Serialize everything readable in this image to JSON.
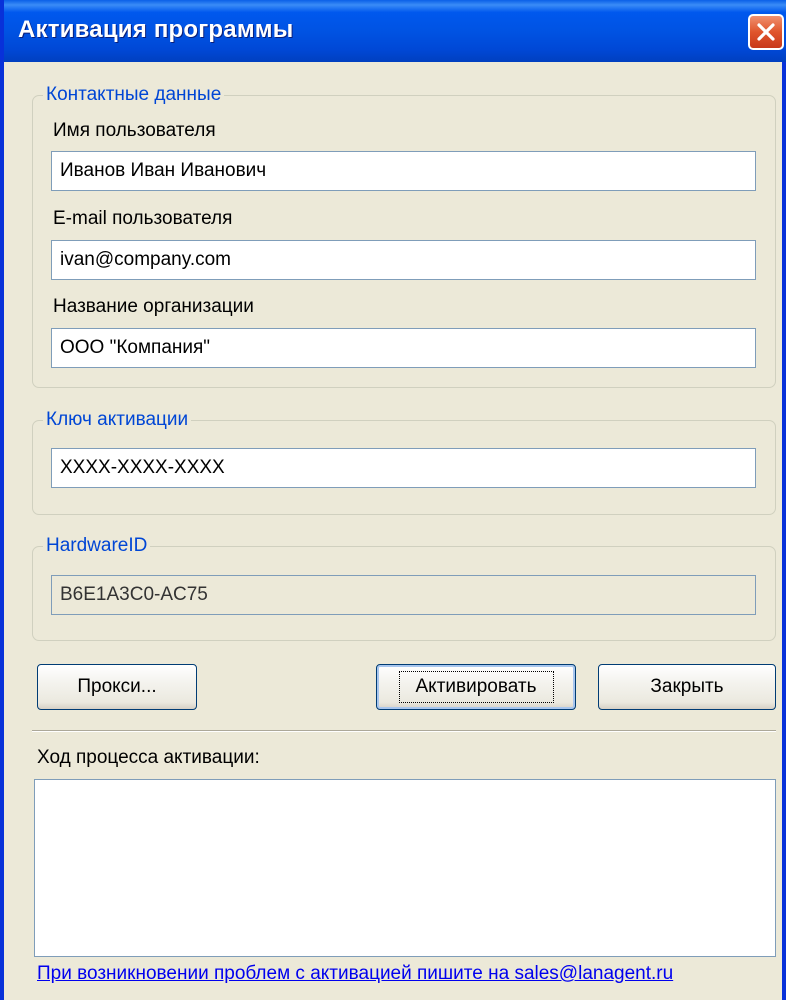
{
  "window": {
    "title": "Активация программы"
  },
  "contacts": {
    "legend": "Контактные данные",
    "username_label": "Имя пользователя",
    "username_value": "Иванов Иван Иванович",
    "email_label": "E-mail пользователя",
    "email_value": "ivan@company.com",
    "org_label": "Название организации",
    "org_value": "ООО \"Компания\""
  },
  "activation_key": {
    "legend": "Ключ активации",
    "value": "XXXX-XXXX-XXXX"
  },
  "hardware": {
    "legend": "HardwareID",
    "value": "B6E1A3C0-AC75"
  },
  "buttons": {
    "proxy": "Прокси...",
    "activate": "Активировать",
    "close": "Закрыть"
  },
  "progress": {
    "label": "Ход процесса активации:"
  },
  "footer": {
    "link_text": "При возникновении проблем с активацией пишите на sales@lanagent.ru"
  },
  "colors": {
    "titlebar": "#0053e3",
    "legend": "#0046d5",
    "link": "#0000ee",
    "dialog_bg": "#ece9d8"
  }
}
